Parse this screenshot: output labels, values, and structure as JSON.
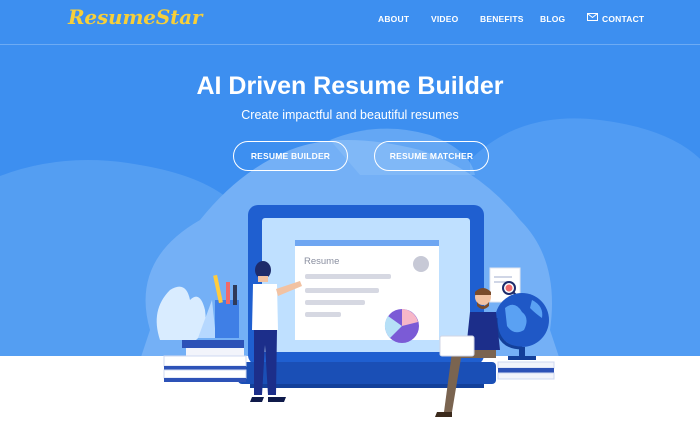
{
  "brand": {
    "name": "ResumeStar"
  },
  "nav": {
    "about": "ABOUT",
    "video": "VIDEO",
    "benefits": "BENEFITS",
    "blog": "BLOG",
    "contact": "CONTACT"
  },
  "hero": {
    "title": "AI Driven Resume Builder",
    "subtitle": "Create impactful and beautiful resumes",
    "buttons": {
      "builder": "RESUME BUILDER",
      "matcher": "RESUME MATCHER"
    }
  },
  "illustration": {
    "document_label": "Resume"
  },
  "colors": {
    "hero_bg": "#3d8ff0",
    "logo": "#f6cf3a",
    "accent_dark": "#1f4fc4"
  }
}
